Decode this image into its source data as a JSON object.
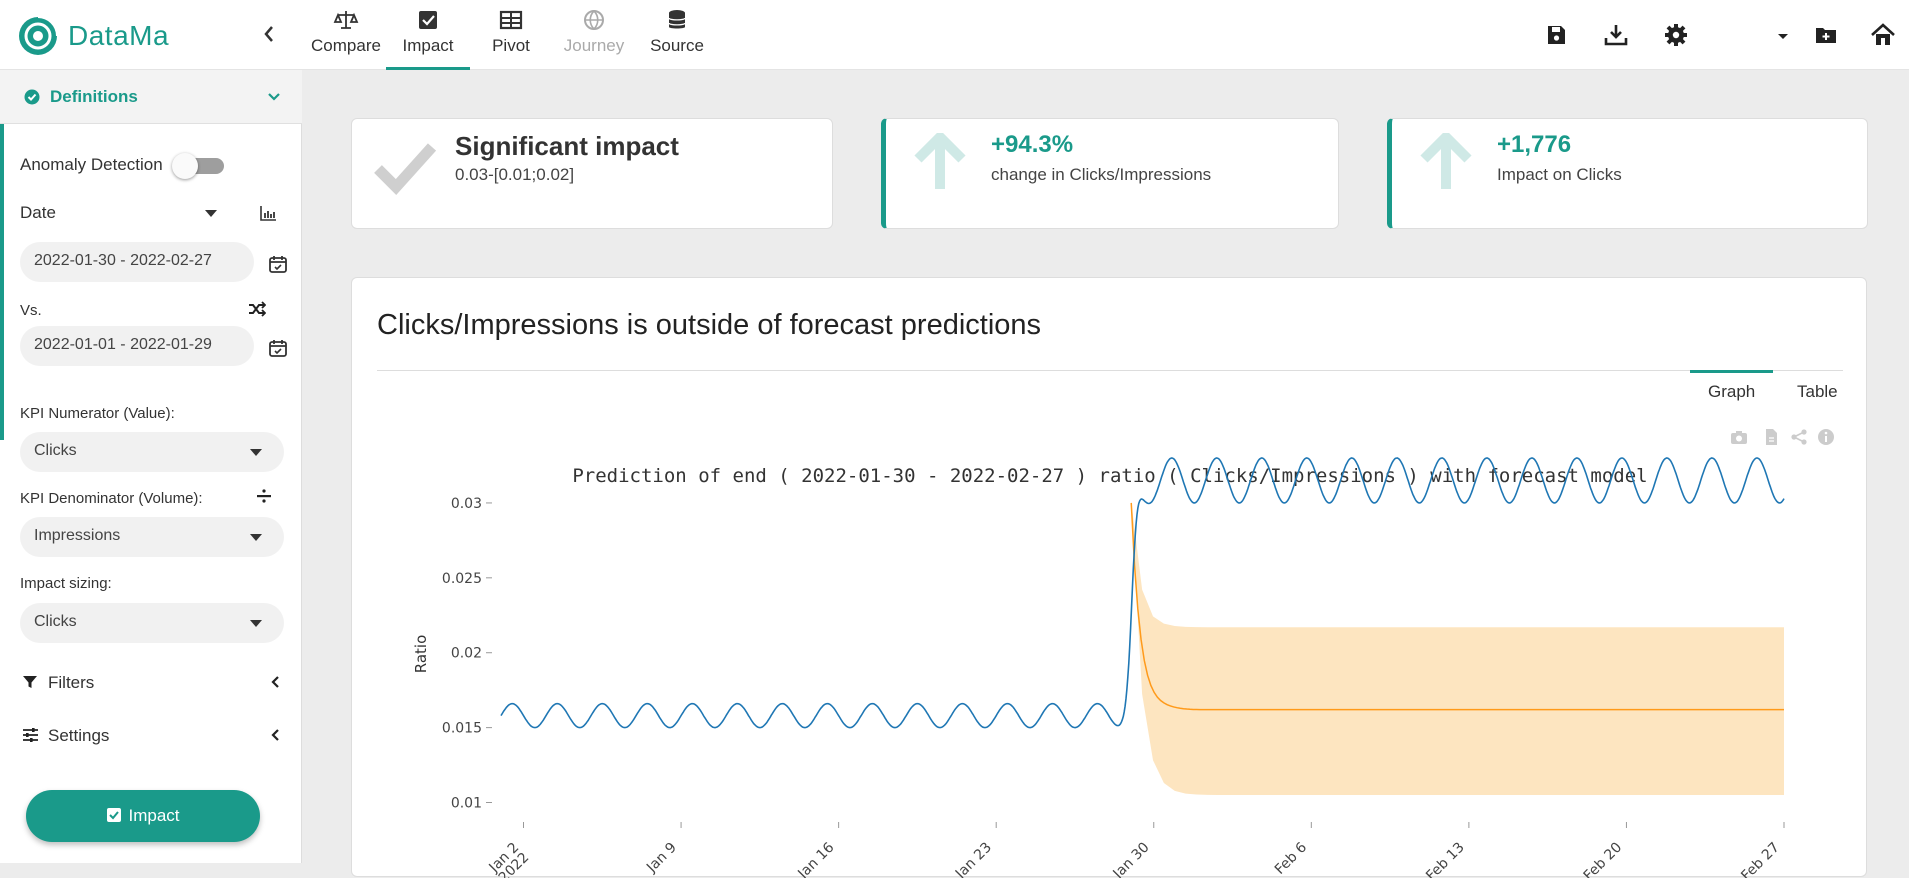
{
  "app": {
    "name": "DataMa"
  },
  "nav": {
    "collapse_icon": "chevron-left-icon",
    "tabs": [
      {
        "label": "Compare",
        "icon": "scale-icon",
        "state": "normal"
      },
      {
        "label": "Impact",
        "icon": "checkbox-icon",
        "state": "active"
      },
      {
        "label": "Pivot",
        "icon": "table-icon",
        "state": "normal"
      },
      {
        "label": "Journey",
        "icon": "globe-icon",
        "state": "disabled"
      },
      {
        "label": "Source",
        "icon": "database-icon",
        "state": "normal"
      }
    ],
    "right_icons": [
      "save-icon",
      "download-icon",
      "gear-icon",
      "caret-down-icon",
      "folder-plus-icon",
      "home-icon"
    ]
  },
  "sidebar": {
    "definitions_label": "Definitions",
    "anomaly_label": "Anomaly Detection",
    "anomaly_enabled": false,
    "date_label": "Date",
    "date_range": "2022-01-30 - 2022-02-27",
    "vs_label": "Vs.",
    "vs_range": "2022-01-01 - 2022-01-29",
    "kpi_num_label": "KPI Numerator (Value):",
    "kpi_num_value": "Clicks",
    "kpi_den_label": "KPI Denominator (Volume):",
    "kpi_den_value": "Impressions",
    "impact_sizing_label": "Impact sizing:",
    "impact_sizing_value": "Clicks",
    "filters_label": "Filters",
    "settings_label": "Settings",
    "impact_button": "Impact"
  },
  "cards": [
    {
      "title": "Significant impact",
      "subtitle": "0.03-[0.01;0.02]",
      "icon": "check-icon"
    },
    {
      "title": "+94.3%",
      "subtitle": "change in Clicks/Impressions",
      "icon": "arrow-up-icon"
    },
    {
      "title": "+1,776",
      "subtitle": "Impact on Clicks",
      "icon": "arrow-up-icon"
    }
  ],
  "panel": {
    "title": "Clicks/Impressions is outside of forecast predictions",
    "tabs": [
      "Graph",
      "Table"
    ],
    "active_tab": "Graph",
    "modebar_icons": [
      "camera-icon",
      "file-icon",
      "share-icon",
      "info-icon"
    ]
  },
  "chart_data": {
    "type": "line",
    "title": "Prediction of end ( 2022-01-30 - 2022-02-27 ) ratio ( Clicks/Impressions ) with forecast model",
    "ylabel": "Ratio",
    "ylim": [
      0.0095,
      0.033
    ],
    "yticks": [
      0.01,
      0.015,
      0.02,
      0.025,
      0.03
    ],
    "ytick_labels": [
      "0.01",
      "0.015",
      "0.02",
      "0.025",
      "0.03"
    ],
    "xticks": [
      "2022-01-02",
      "2022-01-09",
      "2022-01-16",
      "2022-01-23",
      "2022-01-30",
      "2022-02-06",
      "2022-02-13",
      "2022-02-20",
      "2022-02-27"
    ],
    "xtick_labels": [
      "Jan 2\n2022",
      "Jan 9",
      "Jan 16",
      "Jan 23",
      "Jan 30",
      "Feb 6",
      "Feb 13",
      "Feb 20",
      "Feb 27"
    ],
    "xrange": [
      "2022-01-01",
      "2022-02-27"
    ],
    "series": [
      {
        "kind": "actual",
        "color": "#1f77b4",
        "pre_level": 0.0158,
        "pre_amplitude": 0.0008,
        "post_level": 0.0315,
        "post_amplitude": 0.0015,
        "period_days": 2,
        "jump_date": "2022-01-29"
      },
      {
        "kind": "forecast",
        "color": "#ff9a1a",
        "start_value": 0.03,
        "level": 0.0162,
        "start_date": "2022-01-29"
      }
    ],
    "band": {
      "fill": "#fde5c0",
      "lower": 0.0105,
      "upper": 0.0217,
      "start_date": "2022-01-29"
    }
  }
}
